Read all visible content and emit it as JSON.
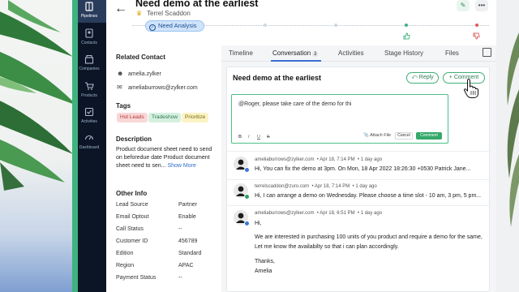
{
  "sidebar": {
    "items": [
      {
        "label": "Pipelines",
        "icon": "pipelines-icon"
      },
      {
        "label": "Contacts",
        "icon": "contacts-icon"
      },
      {
        "label": "Companies",
        "icon": "companies-icon"
      },
      {
        "label": "Products",
        "icon": "products-icon"
      },
      {
        "label": "Activities",
        "icon": "activities-icon"
      },
      {
        "label": "Dashboard",
        "icon": "dashboard-icon"
      }
    ]
  },
  "header": {
    "title": "Need demo at the earliest",
    "owner": "Terrel Scaddon",
    "stage": "Need Analysis"
  },
  "details": {
    "related_contact_title": "Related Contact",
    "contact_name": "amelia.zylker",
    "contact_email": "ameliaburrows@zylker.com",
    "tags_title": "Tags",
    "tags": [
      "Hot Leads",
      "Tradeshow",
      "Prioritize"
    ],
    "description_title": "Description",
    "description": "Product document sheet need to send on beforedue date Product document sheet need to sen...",
    "show_more": "Show More",
    "other_info_title": "Other Info",
    "other_info": [
      {
        "key": "Lead Source",
        "value": "Partner"
      },
      {
        "key": "Email Optout",
        "value": "Enable"
      },
      {
        "key": "Call Status",
        "value": "--"
      },
      {
        "key": "Customer ID",
        "value": "456789"
      },
      {
        "key": "Edition",
        "value": "Standard"
      },
      {
        "key": "Region",
        "value": "APAC"
      },
      {
        "key": "Payment Status",
        "value": "--"
      }
    ]
  },
  "tabs": [
    {
      "label": "Timeline"
    },
    {
      "label": "Conversation",
      "badge": "3"
    },
    {
      "label": "Activities"
    },
    {
      "label": "Stage History"
    },
    {
      "label": "Files"
    }
  ],
  "conversation": {
    "title": "Need demo at the earliest",
    "reply_label": "Reply",
    "comment_label": "Comment",
    "composer_text": "@Roger, please take care of the demo for thi",
    "format_bold": "B",
    "format_italic": "I",
    "format_underline": "U",
    "format_strike": "S",
    "attach_label": "Attach File",
    "cancel_label": "Cancel",
    "post_label": "Comment",
    "messages": [
      {
        "sender": "ameliaburrows@zylker.com",
        "time": "Apr 18, 7:14 PM",
        "ago": "1 day ago",
        "lines": [
          "Hi, You can fix the demo at 3pm. On Mon, 18 Apr 2022 18:26:30 +0530  Patrick Jane..."
        ]
      },
      {
        "sender": "terrelscaddon@zuro.com",
        "time": "Apr 18, 7:14 PM",
        "ago": "1 day ago",
        "lines": [
          "Hi, I can arrange a demo on Wednesday. Please choose a time slot - 10 am, 3 pm, 5 pm..."
        ]
      },
      {
        "sender": "ameliaburrows@zylker.com",
        "time": "Apr 18, 6:51 PM",
        "ago": "1 day ago",
        "lines": [
          "Hi,",
          "We are interested in purchasing 100 units of you product and require a demo for the same,",
          "Let me know the availabilty so that i can plan accordingly.",
          "Thanks,",
          "Amelia"
        ]
      }
    ]
  },
  "colors": {
    "sidebar": "#0b1526",
    "accent_green": "#3fb37f",
    "stage_pill": "#cfe3fb",
    "link_blue": "#2f6ec8",
    "tag_hot": "#f9d7d7",
    "tag_tradeshow": "#d6f0e0",
    "tag_prioritize": "#fbf3c4"
  }
}
